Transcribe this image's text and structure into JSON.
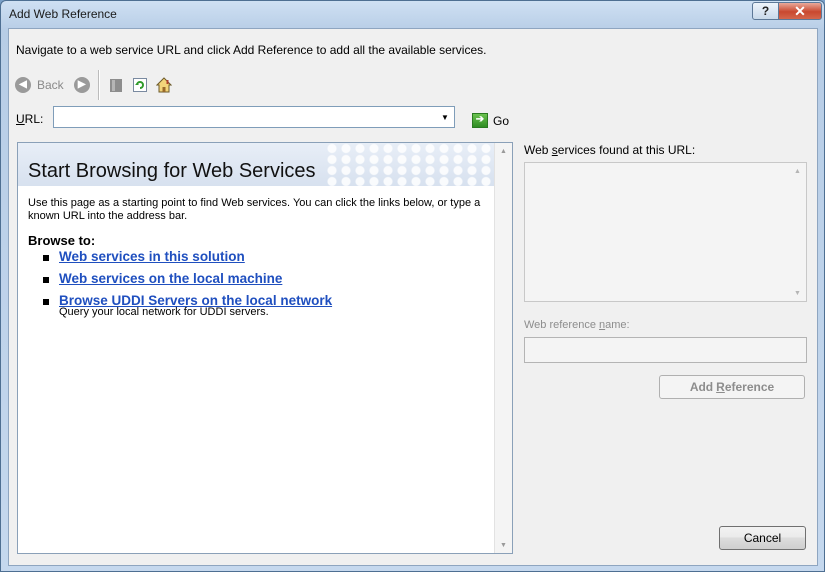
{
  "window": {
    "title": "Add Web Reference",
    "help_button": "?",
    "close_button": "✕"
  },
  "instruction": "Navigate to a web service URL and click Add Reference to add all the available services.",
  "toolbar": {
    "back_label": "Back",
    "icons": [
      "back-icon",
      "forward-icon",
      "stop-icon",
      "refresh-icon",
      "home-icon"
    ]
  },
  "url": {
    "label": "URL:",
    "value": "",
    "go_label": "Go"
  },
  "browser": {
    "title": "Start Browsing for Web Services",
    "intro": "Use this page as a starting point to find Web services. You can click the links below, or type a known URL into the address bar.",
    "browse_heading": "Browse to:",
    "links": [
      {
        "label": "Web services in this solution",
        "description": ""
      },
      {
        "label": "Web services on the local machine",
        "description": ""
      },
      {
        "label": "Browse UDDI Servers on the local network",
        "description": "Query your local network for UDDI servers."
      }
    ]
  },
  "side": {
    "found_label": "Web services found at this URL:",
    "ref_name_label": "Web reference name:",
    "ref_name_value": "",
    "add_reference_label": "Add Reference"
  },
  "footer": {
    "cancel_label": "Cancel"
  },
  "colors": {
    "link": "#1f4fbf",
    "close_button": "#c9482f",
    "disabled_text": "#8d8d8d"
  }
}
